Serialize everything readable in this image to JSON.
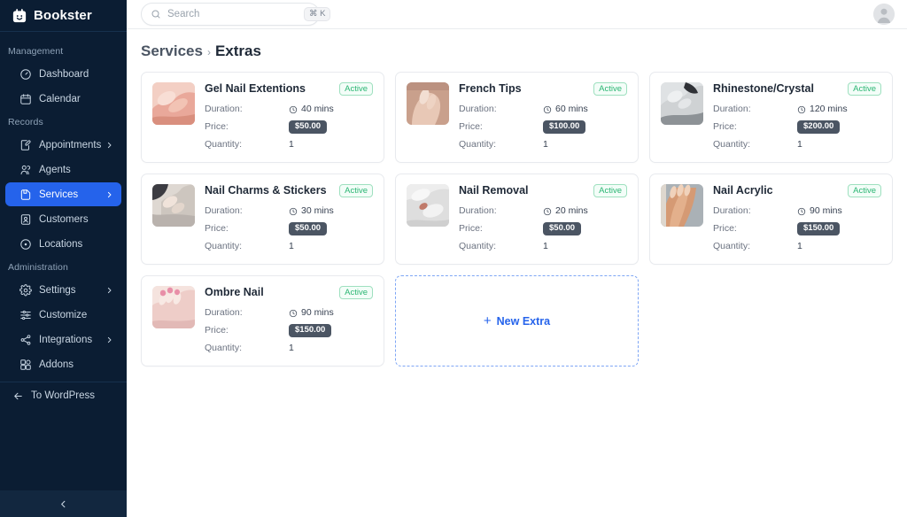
{
  "brand": {
    "name": "Bookster",
    "logo_icon": "calendar-smile-icon"
  },
  "sidebar": {
    "sections": [
      {
        "label": "Management",
        "items": [
          {
            "label": "Dashboard",
            "icon": "gauge-icon",
            "has_chevron": false,
            "active": false
          },
          {
            "label": "Calendar",
            "icon": "calendar-icon",
            "has_chevron": false,
            "active": false
          }
        ]
      },
      {
        "label": "Records",
        "items": [
          {
            "label": "Appointments",
            "icon": "note-edit-icon",
            "has_chevron": true,
            "active": false
          },
          {
            "label": "Agents",
            "icon": "users-icon",
            "has_chevron": false,
            "active": false
          },
          {
            "label": "Services",
            "icon": "save-box-icon",
            "has_chevron": true,
            "active": true
          },
          {
            "label": "Customers",
            "icon": "id-card-icon",
            "has_chevron": false,
            "active": false
          },
          {
            "label": "Locations",
            "icon": "map-pin-icon",
            "has_chevron": false,
            "active": false
          }
        ]
      },
      {
        "label": "Administration",
        "items": [
          {
            "label": "Settings",
            "icon": "gear-icon",
            "has_chevron": true,
            "active": false
          },
          {
            "label": "Customize",
            "icon": "sliders-icon",
            "has_chevron": false,
            "active": false
          },
          {
            "label": "Integrations",
            "icon": "share-nodes-icon",
            "has_chevron": true,
            "active": false
          },
          {
            "label": "Addons",
            "icon": "blocks-icon",
            "has_chevron": false,
            "active": false
          }
        ]
      }
    ],
    "footer_link": {
      "label": "To WordPress",
      "icon": "arrow-left-icon"
    },
    "collapse_icon": "chevron-left-icon",
    "active_color": "#2563eb",
    "background_color": "#0b1d33"
  },
  "topbar": {
    "search": {
      "placeholder": "Search",
      "value": "",
      "icon": "search-icon",
      "shortcut": "⌘ K"
    },
    "avatar_icon": "user-avatar-icon"
  },
  "breadcrumb": {
    "parent": "Services",
    "separator": "›",
    "current": "Extras"
  },
  "labels": {
    "duration": "Duration:",
    "price": "Price:",
    "quantity": "Quantity:",
    "status_active": "Active"
  },
  "extras": [
    {
      "title": "Gel Nail Extentions",
      "duration": "40 mins",
      "price": "$50.00",
      "quantity": "1",
      "status": "Active",
      "thumb_icon": "nail-photo-gel",
      "thumb_colors": [
        "#e9a89a",
        "#f6d8cf",
        "#d98f7e"
      ]
    },
    {
      "title": "French Tips",
      "duration": "60 mins",
      "price": "$100.00",
      "quantity": "1",
      "status": "Active",
      "thumb_icon": "nail-photo-french",
      "thumb_colors": [
        "#d8b7a6",
        "#f0ddd2",
        "#bb9180"
      ]
    },
    {
      "title": "Rhinestone/Crystal",
      "duration": "120 mins",
      "price": "$200.00",
      "quantity": "1",
      "status": "Active",
      "thumb_icon": "nail-photo-rhinestone",
      "thumb_colors": [
        "#cfd2d4",
        "#eceeef",
        "#8d9296"
      ]
    },
    {
      "title": "Nail Charms & Stickers",
      "duration": "30 mins",
      "price": "$50.00",
      "quantity": "1",
      "status": "Active",
      "thumb_icon": "nail-photo-charms",
      "thumb_colors": [
        "#b9b2ad",
        "#e6e0da",
        "#4a4a50"
      ]
    },
    {
      "title": "Nail Removal",
      "duration": "20 mins",
      "price": "$50.00",
      "quantity": "1",
      "status": "Active",
      "thumb_icon": "nail-photo-removal",
      "thumb_colors": [
        "#d9d9d9",
        "#f2f2f2",
        "#c07a6a"
      ]
    },
    {
      "title": "Nail Acrylic",
      "duration": "90 mins",
      "price": "$150.00",
      "quantity": "1",
      "status": "Active",
      "thumb_icon": "nail-photo-acrylic",
      "thumb_colors": [
        "#c98a62",
        "#e8c0a2",
        "#9aa2a8"
      ]
    },
    {
      "title": "Ombre Nail",
      "duration": "90 mins",
      "price": "$150.00",
      "quantity": "1",
      "status": "Active",
      "thumb_icon": "nail-photo-ombre",
      "thumb_colors": [
        "#edc7c7",
        "#f7e4e0",
        "#d98aa0"
      ]
    }
  ],
  "new_extra": {
    "label": "New Extra",
    "plus": "+"
  },
  "colors": {
    "accent": "#2563eb",
    "price_badge": "#4b5563",
    "active_badge_text": "#2bb673",
    "active_badge_border": "#9ee0bf"
  }
}
